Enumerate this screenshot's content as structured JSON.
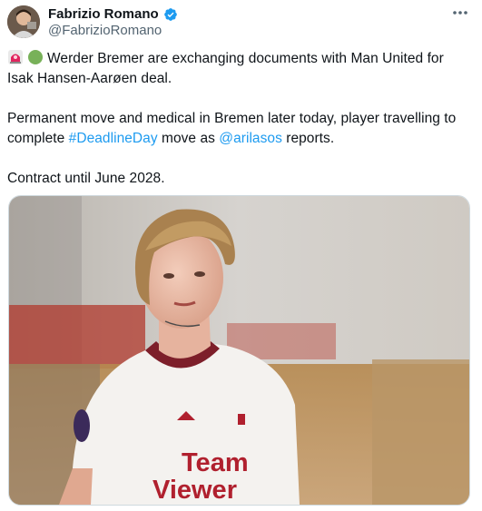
{
  "author": {
    "name": "Fabrizio Romano",
    "handle": "@FabrizioRomano",
    "verified": true,
    "avatar_icon": "profile-photo"
  },
  "menu_icon": "more-horizontal-icon",
  "post": {
    "line1_emojis": [
      "siren-emoji",
      "green-circle-emoji"
    ],
    "line1": "Werder Bremer are exchanging documents with Man United for Isak Hansen-Aarøen deal.",
    "line2_before": "Permanent move and medical in Bremen later today, player travelling to complete ",
    "hashtag": "#DeadlineDay",
    "line2_middle": " move as ",
    "mention": "@arilasos",
    "line2_after": " reports.",
    "line3": "Contract until June 2028."
  },
  "media": {
    "icon": "player-photo",
    "shirt_text_line1": "Team",
    "shirt_text_line2": "Viewer"
  },
  "colors": {
    "link": "#1d9bf0",
    "verified": "#1d9bf0",
    "handle": "#536471",
    "text": "#0f1419"
  }
}
